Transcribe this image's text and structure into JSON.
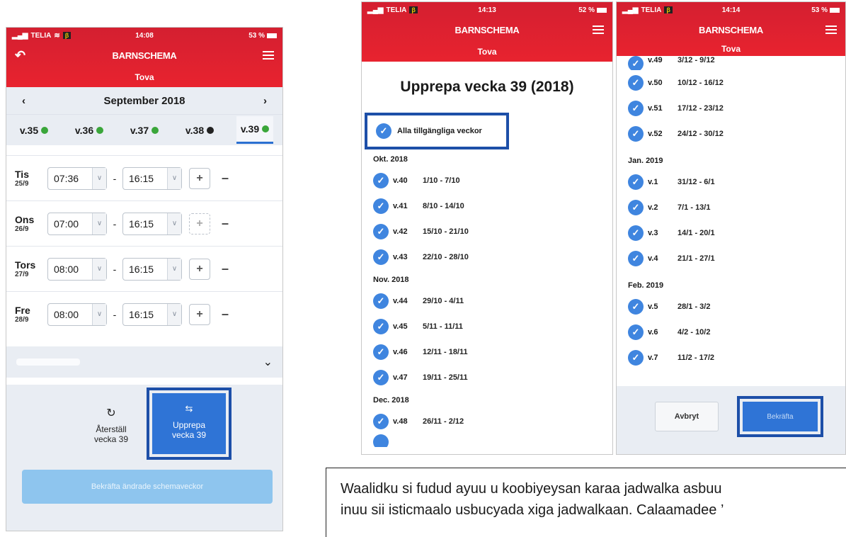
{
  "status": {
    "carrier": "TELIA",
    "beta": "β",
    "p1_time": "14:08",
    "p1_battery": "53 %",
    "p2_time": "14:13",
    "p2_battery": "52 %",
    "p3_time": "14:14",
    "p3_battery": "53 %"
  },
  "header": {
    "app_title": "BARNSCHEMA",
    "child_name": "Tova"
  },
  "schedule": {
    "month_label": "September 2018",
    "weeks": [
      {
        "label": "v.35",
        "status": "green"
      },
      {
        "label": "v.36",
        "status": "green"
      },
      {
        "label": "v.37",
        "status": "green"
      },
      {
        "label": "v.38",
        "status": "dark"
      },
      {
        "label": "v.39",
        "status": "green"
      }
    ],
    "days": [
      {
        "name": "Tis",
        "date": "25/9",
        "start": "07:36",
        "end": "16:15"
      },
      {
        "name": "Ons",
        "date": "26/9",
        "start": "07:00",
        "end": "16:15"
      },
      {
        "name": "Tors",
        "date": "27/9",
        "start": "08:00",
        "end": "16:15"
      },
      {
        "name": "Fre",
        "date": "28/9",
        "start": "08:00",
        "end": "16:15"
      }
    ],
    "dash": "-",
    "plus": "+",
    "minus": "–",
    "reset_label_1": "Återställ",
    "reset_label_2": "vecka 39",
    "repeat_label_1": "Upprepa",
    "repeat_label_2": "vecka 39",
    "confirm_label": "Bekräfta ändrade schemaveckor"
  },
  "repeat_dialog": {
    "title": "Upprepa vecka 39 (2018)",
    "all_weeks": "Alla tillgängliga veckor",
    "groups": [
      {
        "month": "Okt. 2018",
        "rows": [
          {
            "w": "v.40",
            "r": "1/10 - 7/10"
          },
          {
            "w": "v.41",
            "r": "8/10 - 14/10"
          },
          {
            "w": "v.42",
            "r": "15/10 - 21/10"
          },
          {
            "w": "v.43",
            "r": "22/10 - 28/10"
          }
        ]
      },
      {
        "month": "Nov. 2018",
        "rows": [
          {
            "w": "v.44",
            "r": "29/10 - 4/11"
          },
          {
            "w": "v.45",
            "r": "5/11 - 11/11"
          },
          {
            "w": "v.46",
            "r": "12/11 - 18/11"
          },
          {
            "w": "v.47",
            "r": "19/11 - 25/11"
          }
        ]
      },
      {
        "month": "Dec. 2018",
        "rows": [
          {
            "w": "v.48",
            "r": "26/11 - 2/12"
          }
        ]
      }
    ]
  },
  "repeat_dialog_scrolled": {
    "top_rows": [
      {
        "w": "v.49",
        "r": "3/12 - 9/12"
      },
      {
        "w": "v.50",
        "r": "10/12 - 16/12"
      },
      {
        "w": "v.51",
        "r": "17/12 - 23/12"
      },
      {
        "w": "v.52",
        "r": "24/12 - 30/12"
      }
    ],
    "groups": [
      {
        "month": "Jan. 2019",
        "rows": [
          {
            "w": "v.1",
            "r": "31/12 - 6/1"
          },
          {
            "w": "v.2",
            "r": "7/1 - 13/1"
          },
          {
            "w": "v.3",
            "r": "14/1 - 20/1"
          },
          {
            "w": "v.4",
            "r": "21/1 - 27/1"
          }
        ]
      },
      {
        "month": "Feb. 2019",
        "rows": [
          {
            "w": "v.5",
            "r": "28/1 - 3/2"
          },
          {
            "w": "v.6",
            "r": "4/2 - 10/2"
          },
          {
            "w": "v.7",
            "r": "11/2 - 17/2"
          }
        ]
      }
    ],
    "cancel_label": "Avbryt",
    "confirm_label": "Bekräfta"
  },
  "caption": {
    "line1": "Waalidku si fudud ayuu u koobiyeysan karaa jadwalka asbuu",
    "line2": "inuu sii  isticmaalo usbucyada xiga jadwalkaan. Calaamadee ’"
  },
  "colors": {
    "header_red": "#e8232f",
    "accent_blue": "#2f74d6",
    "highlight_blue": "#1d4fa8",
    "status_green": "#3aa63a"
  },
  "icons": [
    "back-arrow-icon",
    "hamburger-menu-icon",
    "chevron-left-icon",
    "chevron-right-icon",
    "chevron-down-icon",
    "check-icon",
    "reset-icon",
    "repeat-icon"
  ]
}
